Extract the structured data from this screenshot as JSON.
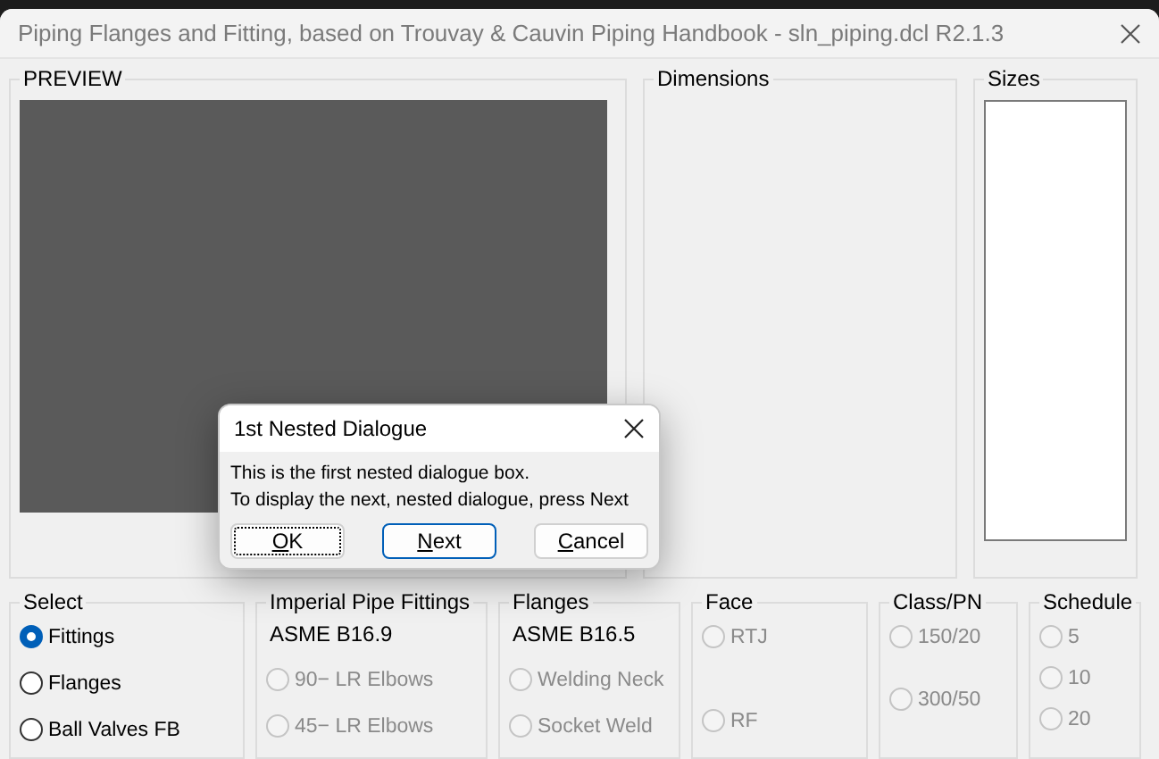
{
  "window": {
    "title": "Piping Flanges and Fitting, based on Trouvay & Cauvin Piping Handbook - sln_piping.dcl R2.1.3",
    "active": false
  },
  "top_groups": [
    {
      "kind": "preview",
      "label": "PREVIEW"
    },
    {
      "kind": "blank",
      "label": "Dimensions"
    },
    {
      "kind": "list",
      "label": "Sizes"
    }
  ],
  "groups": [
    {
      "label": "Select",
      "options": [
        {
          "label": "Fittings",
          "selected": true,
          "disabled": false
        },
        {
          "label": "Flanges",
          "selected": false,
          "disabled": false
        },
        {
          "label": "Ball Valves FB",
          "selected": false,
          "disabled": false
        }
      ]
    },
    {
      "label": "Imperial Pipe Fittings",
      "subtitle": "ASME B16.9",
      "options": [
        {
          "label": "90− LR Elbows",
          "selected": false,
          "disabled": true
        },
        {
          "label": "45− LR Elbows",
          "selected": false,
          "disabled": true
        }
      ]
    },
    {
      "label": "Flanges",
      "subtitle": "ASME B16.5",
      "options": [
        {
          "label": "Welding Neck",
          "selected": false,
          "disabled": true
        },
        {
          "label": "Socket Weld",
          "selected": false,
          "disabled": true
        }
      ]
    },
    {
      "label": "Face",
      "options": [
        {
          "label": "RTJ",
          "selected": false,
          "disabled": true
        },
        {
          "label": "RF",
          "selected": false,
          "disabled": true
        }
      ]
    },
    {
      "label": "Class/PN",
      "options": [
        {
          "label": "150/20",
          "selected": false,
          "disabled": true
        },
        {
          "label": "300/50",
          "selected": false,
          "disabled": true
        }
      ]
    },
    {
      "label": "Schedule",
      "options": [
        {
          "label": "5",
          "selected": false,
          "disabled": true
        },
        {
          "label": "10",
          "selected": false,
          "disabled": true
        },
        {
          "label": "20",
          "selected": false,
          "disabled": true
        }
      ]
    }
  ],
  "dialog": {
    "title": "1st Nested Dialogue",
    "lines": [
      "This is the first nested dialogue box.",
      "To display the next, nested dialogue, press Next"
    ],
    "buttons": [
      {
        "label": "OK",
        "underline_first": true,
        "focused": true,
        "default": false
      },
      {
        "label": "Next",
        "underline_first": true,
        "focused": false,
        "default": true
      },
      {
        "label": "Cancel",
        "underline_first": true,
        "focused": false,
        "default": false
      }
    ]
  }
}
